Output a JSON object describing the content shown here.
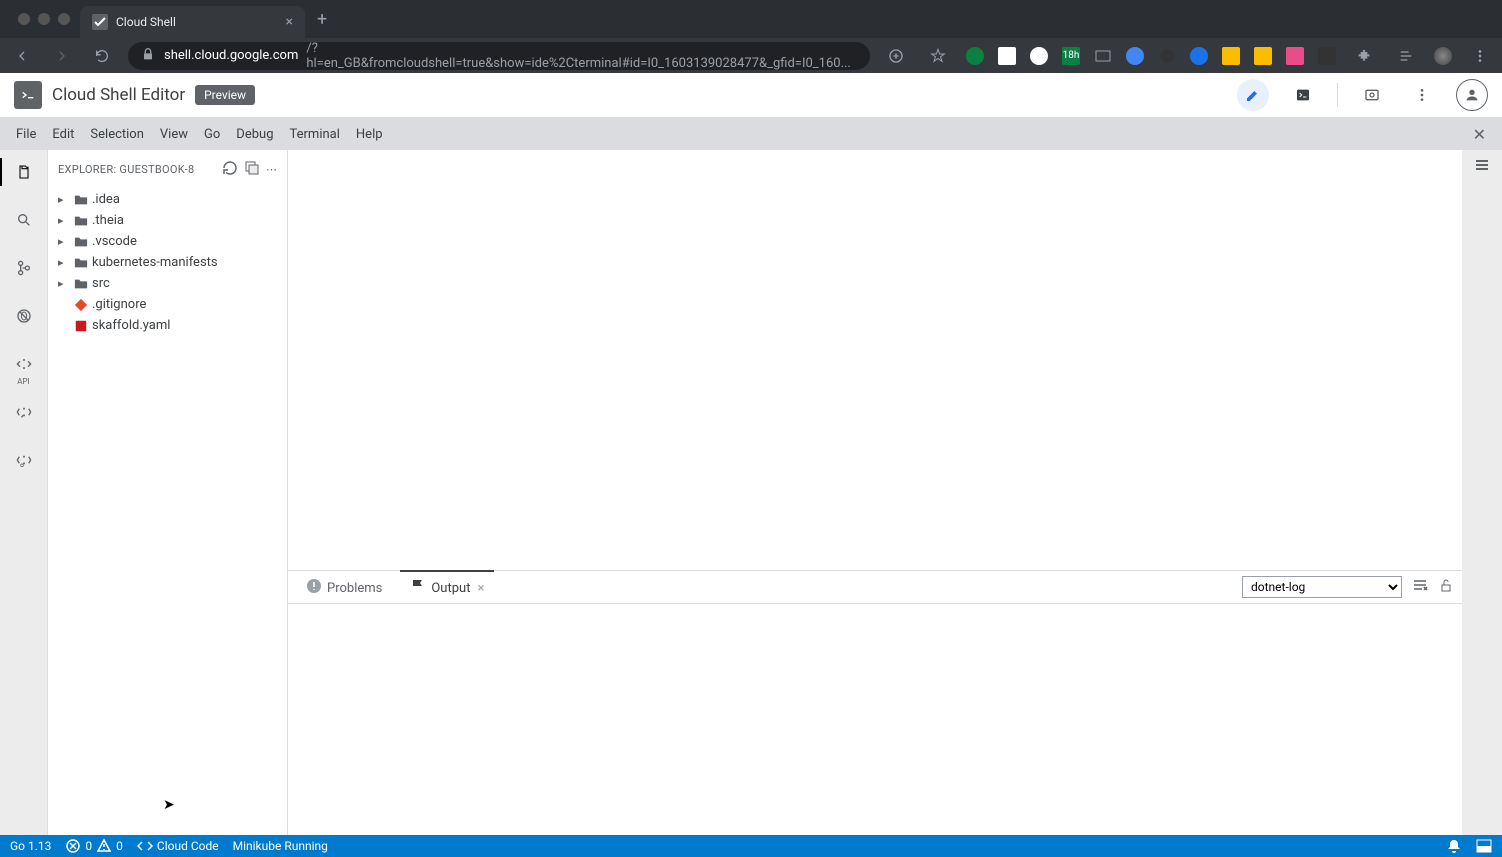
{
  "browser": {
    "tab_title": "Cloud Shell",
    "url_host": "shell.cloud.google.com",
    "url_path": "/?hl=en_GB&fromcloudshell=true&show=ide%2Cterminal#id=I0_1603139028477&_gfid=I0_160..."
  },
  "header": {
    "app_title": "Cloud Shell Editor",
    "preview_label": "Preview"
  },
  "menus": [
    "File",
    "Edit",
    "Selection",
    "View",
    "Go",
    "Debug",
    "Terminal",
    "Help"
  ],
  "explorer": {
    "title": "EXPLORER: GUESTBOOK-8",
    "folders": [
      {
        "name": ".idea"
      },
      {
        "name": ".theia"
      },
      {
        "name": ".vscode"
      },
      {
        "name": "kubernetes-manifests"
      },
      {
        "name": "src"
      }
    ],
    "files": [
      {
        "name": ".gitignore",
        "icon_color": "#e34c26"
      },
      {
        "name": "skaffold.yaml",
        "icon_color": "#cb171e"
      }
    ]
  },
  "panel": {
    "tabs": {
      "problems": "Problems",
      "output": "Output"
    },
    "select_value": "dotnet-log"
  },
  "status": {
    "go_version": "Go 1.13",
    "errors": "0",
    "warnings": "0",
    "cloud_code": "Cloud Code",
    "minikube": "Minikube Running"
  },
  "ext_badge": "18h"
}
